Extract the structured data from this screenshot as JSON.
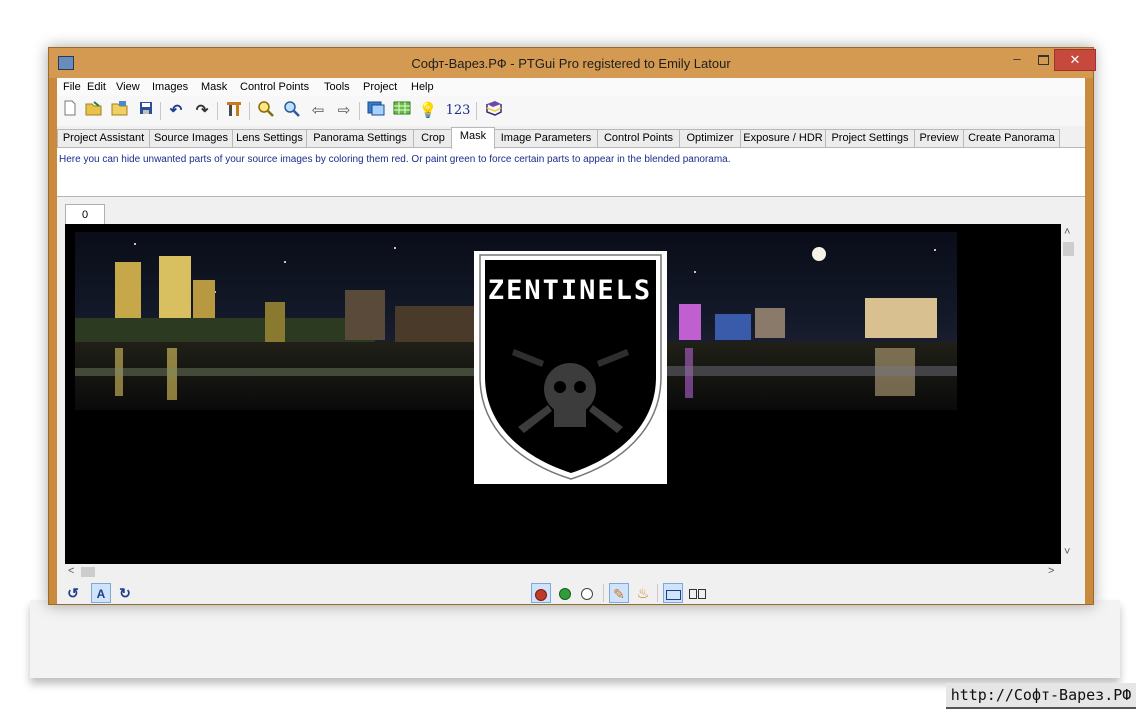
{
  "window": {
    "title": "Софт-Варез.РФ - PTGui Pro registered to Emily Latour",
    "minimize": "–",
    "close": "✕"
  },
  "menu": [
    "File",
    "Edit",
    "View",
    "Images",
    "Mask",
    "Control Points",
    "Tools",
    "Project",
    "Help"
  ],
  "toolbar": {
    "icons": [
      "new-project-icon",
      "open-project-icon",
      "load-images-icon",
      "save-icon",
      "undo-icon",
      "redo-icon",
      "align-images-icon",
      "zoom-in-icon",
      "zoom-out-icon",
      "back-icon",
      "forward-icon",
      "panorama-editor-icon",
      "control-point-table-icon",
      "tips-icon",
      "numbering-icon",
      "help-book-icon"
    ],
    "numbers_label": "123"
  },
  "tabs": [
    "Project Assistant",
    "Source Images",
    "Lens Settings",
    "Panorama Settings",
    "Crop",
    "Mask",
    "Image Parameters",
    "Control Points",
    "Optimizer",
    "Exposure / HDR",
    "Project Settings",
    "Preview",
    "Create Panorama"
  ],
  "active_tab": "Mask",
  "info_text": "Here you can hide unwanted parts of your source images by coloring them red. Or paint green to force certain parts to appear in the blended panorama.",
  "image_tab": "0",
  "logo_text": "ZENTINELS",
  "scroll": {
    "up": "˄",
    "down": "˅",
    "left": "<",
    "right": ">"
  },
  "bottom_toolbar": {
    "auto_label": "A",
    "left_icons": [
      "rotate-left-icon",
      "auto-mask-icon",
      "rotate-right-icon"
    ],
    "mask_colors": {
      "red": "#c0392b",
      "green": "#2e9e3a",
      "clear": "#ffffff"
    }
  },
  "watermark": "http://Софт-Варез.РФ",
  "colors": {
    "titlebar": "#d49a52",
    "close": "#c7483c",
    "info_text": "#1a2d8e"
  }
}
